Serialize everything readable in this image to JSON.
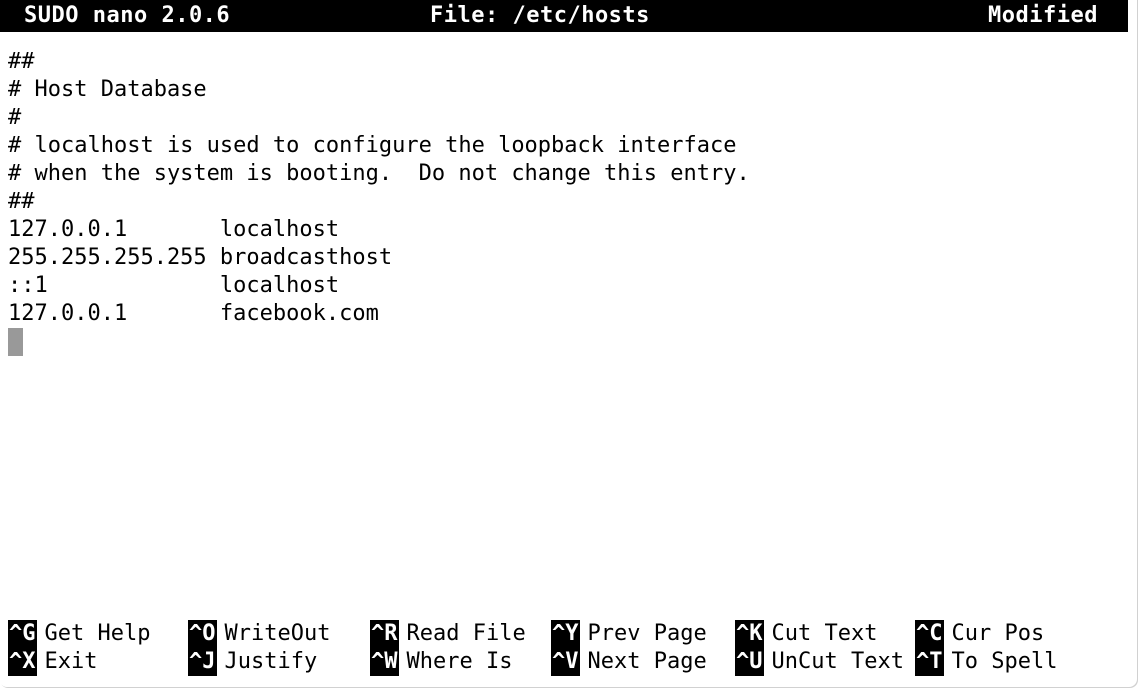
{
  "titlebar": {
    "app": "SUDO nano 2.0.6",
    "file": "File: /etc/hosts",
    "status": "Modified",
    "background": "#000000",
    "foreground": "#ffffff"
  },
  "editor": {
    "background": "#ffffff",
    "foreground": "#000000",
    "cursor_color": "#999999",
    "cursor_line": 10,
    "cursor_column": 1,
    "lines": [
      "##",
      "# Host Database",
      "#",
      "# localhost is used to configure the loopback interface",
      "# when the system is booting.  Do not change this entry.",
      "##",
      "127.0.0.1\t      localhost",
      "255.255.255.255 broadcasthost",
      "::1             localhost",
      "127.0.0.1\t      facebook.com",
      ""
    ],
    "lines_plain": [
      "##",
      "# Host Database",
      "#",
      "# localhost is used to configure the loopback interface",
      "# when the system is booting.  Do not change this entry.",
      "##",
      "127.0.0.1       localhost",
      "255.255.255.255 broadcasthost",
      "::1             localhost",
      "127.0.0.1       facebook.com",
      ""
    ]
  },
  "helpbar": {
    "items": [
      {
        "key": "^G",
        "label": "Get Help",
        "col": 0,
        "row": 0
      },
      {
        "key": "^X",
        "label": "Exit",
        "col": 0,
        "row": 1
      },
      {
        "key": "^O",
        "label": "WriteOut",
        "col": 1,
        "row": 0
      },
      {
        "key": "^J",
        "label": "Justify",
        "col": 1,
        "row": 1
      },
      {
        "key": "^R",
        "label": "Read File",
        "col": 2,
        "row": 0
      },
      {
        "key": "^W",
        "label": "Where Is",
        "col": 2,
        "row": 1
      },
      {
        "key": "^Y",
        "label": "Prev Page",
        "col": 3,
        "row": 0
      },
      {
        "key": "^V",
        "label": "Next Page",
        "col": 3,
        "row": 1
      },
      {
        "key": "^K",
        "label": "Cut Text",
        "col": 4,
        "row": 0
      },
      {
        "key": "^U",
        "label": "UnCut Text",
        "col": 4,
        "row": 1
      },
      {
        "key": "^C",
        "label": "Cur Pos",
        "col": 5,
        "row": 0
      },
      {
        "key": "^T",
        "label": "To Spell",
        "col": 5,
        "row": 1
      }
    ]
  }
}
